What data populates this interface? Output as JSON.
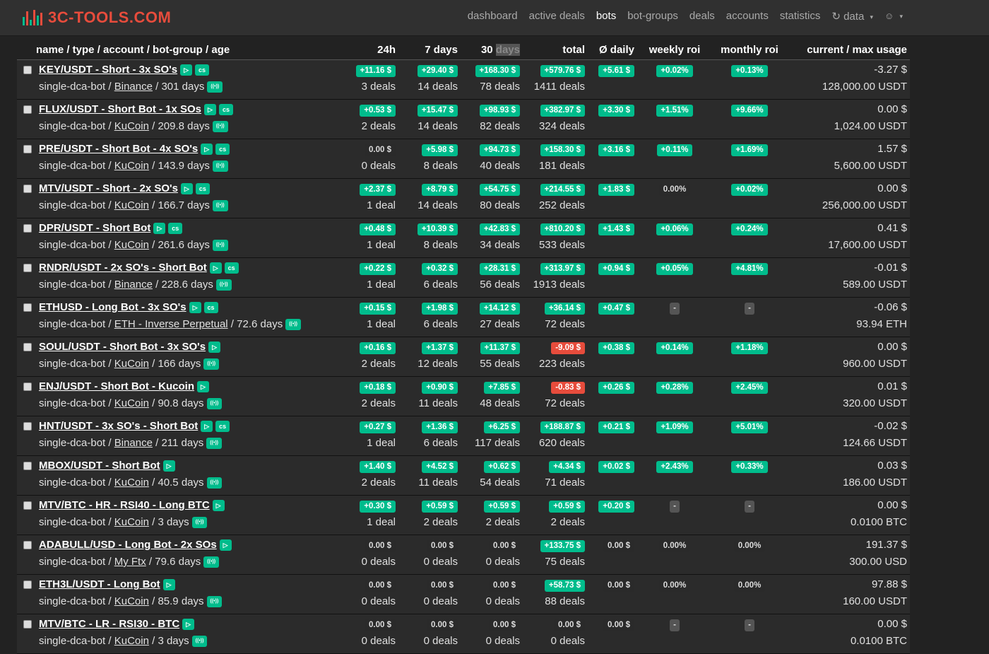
{
  "brand": {
    "title": "3C-TOOLS.COM",
    "logo_colors": [
      "#00bc8c",
      "#e74c3c",
      "#00bc8c",
      "#e74c3c",
      "#00bc8c",
      "#e74c3c"
    ]
  },
  "nav": {
    "items": [
      "dashboard",
      "active deals",
      "bots",
      "bot-groups",
      "deals",
      "accounts",
      "statistics"
    ],
    "active": "bots",
    "data_label": "data"
  },
  "columns": {
    "name": "name / type / account / bot-group / age",
    "h24": "24h",
    "d7": "7 days",
    "d30a": "30",
    "d30b": "days",
    "total": "total",
    "daily": "Ø daily",
    "weekly": "weekly roi",
    "monthly": "monthly roi",
    "usage": "current / max usage"
  },
  "rows": [
    {
      "name": "KEY/USDT - Short - 3x SO's",
      "cs": true,
      "type": "single-dca-bot",
      "exchange": "Binance",
      "age": "301 days",
      "h24": {
        "v": "+11.16 $",
        "c": "green"
      },
      "h24d": "3 deals",
      "d7": {
        "v": "+29.40 $",
        "c": "green"
      },
      "d7d": "14 deals",
      "d30": {
        "v": "+168.30 $",
        "c": "green"
      },
      "d30d": "78 deals",
      "tot": {
        "v": "+579.76 $",
        "c": "green"
      },
      "totd": "1411 deals",
      "daily": {
        "v": "+5.61 $",
        "c": "green"
      },
      "weekly": {
        "v": "+0.02%",
        "c": "green"
      },
      "monthly": {
        "v": "+0.13%",
        "c": "green"
      },
      "cur": "-3.27 $",
      "max": "128,000.00 USDT"
    },
    {
      "name": "FLUX/USDT - Short Bot - 1x SOs",
      "cs": true,
      "type": "single-dca-bot",
      "exchange": "KuCoin",
      "age": "209.8 days",
      "h24": {
        "v": "+0.53 $",
        "c": "green"
      },
      "h24d": "2 deals",
      "d7": {
        "v": "+15.47 $",
        "c": "green"
      },
      "d7d": "14 deals",
      "d30": {
        "v": "+98.93 $",
        "c": "green"
      },
      "d30d": "82 deals",
      "tot": {
        "v": "+382.97 $",
        "c": "green"
      },
      "totd": "324 deals",
      "daily": {
        "v": "+3.30 $",
        "c": "green"
      },
      "weekly": {
        "v": "+1.51%",
        "c": "green"
      },
      "monthly": {
        "v": "+9.66%",
        "c": "green"
      },
      "cur": "0.00 $",
      "max": "1,024.00 USDT"
    },
    {
      "name": "PRE/USDT - Short Bot - 4x SO's",
      "cs": true,
      "type": "single-dca-bot",
      "exchange": "KuCoin",
      "age": "143.9 days",
      "h24": {
        "v": "0.00 $",
        "c": "dark"
      },
      "h24d": "0 deals",
      "d7": {
        "v": "+5.98 $",
        "c": "green"
      },
      "d7d": "8 deals",
      "d30": {
        "v": "+94.73 $",
        "c": "green"
      },
      "d30d": "40 deals",
      "tot": {
        "v": "+158.30 $",
        "c": "green"
      },
      "totd": "181 deals",
      "daily": {
        "v": "+3.16 $",
        "c": "green"
      },
      "weekly": {
        "v": "+0.11%",
        "c": "green"
      },
      "monthly": {
        "v": "+1.69%",
        "c": "green"
      },
      "cur": "1.57 $",
      "max": "5,600.00 USDT"
    },
    {
      "name": "MTV/USDT - Short - 2x SO's",
      "cs": true,
      "type": "single-dca-bot",
      "exchange": "KuCoin",
      "age": "166.7 days",
      "h24": {
        "v": "+2.37 $",
        "c": "green"
      },
      "h24d": "1 deal",
      "d7": {
        "v": "+8.79 $",
        "c": "green"
      },
      "d7d": "14 deals",
      "d30": {
        "v": "+54.75 $",
        "c": "green"
      },
      "d30d": "80 deals",
      "tot": {
        "v": "+214.55 $",
        "c": "green"
      },
      "totd": "252 deals",
      "daily": {
        "v": "+1.83 $",
        "c": "green"
      },
      "weekly": {
        "v": "0.00%",
        "c": "dark"
      },
      "monthly": {
        "v": "+0.02%",
        "c": "green"
      },
      "cur": "0.00 $",
      "max": "256,000.00 USDT"
    },
    {
      "name": "DPR/USDT - Short Bot",
      "cs": true,
      "type": "single-dca-bot",
      "exchange": "KuCoin",
      "age": "261.6 days",
      "h24": {
        "v": "+0.48 $",
        "c": "green"
      },
      "h24d": "1 deal",
      "d7": {
        "v": "+10.39 $",
        "c": "green"
      },
      "d7d": "8 deals",
      "d30": {
        "v": "+42.83 $",
        "c": "green"
      },
      "d30d": "34 deals",
      "tot": {
        "v": "+810.20 $",
        "c": "green"
      },
      "totd": "533 deals",
      "daily": {
        "v": "+1.43 $",
        "c": "green"
      },
      "weekly": {
        "v": "+0.06%",
        "c": "green"
      },
      "monthly": {
        "v": "+0.24%",
        "c": "green"
      },
      "cur": "0.41 $",
      "max": "17,600.00 USDT"
    },
    {
      "name": "RNDR/USDT - 2x SO's - Short Bot",
      "cs": true,
      "type": "single-dca-bot",
      "exchange": "Binance",
      "age": "228.6 days",
      "h24": {
        "v": "+0.22 $",
        "c": "green"
      },
      "h24d": "1 deal",
      "d7": {
        "v": "+0.32 $",
        "c": "green"
      },
      "d7d": "6 deals",
      "d30": {
        "v": "+28.31 $",
        "c": "green"
      },
      "d30d": "56 deals",
      "tot": {
        "v": "+313.97 $",
        "c": "green"
      },
      "totd": "1913 deals",
      "daily": {
        "v": "+0.94 $",
        "c": "green"
      },
      "weekly": {
        "v": "+0.05%",
        "c": "green"
      },
      "monthly": {
        "v": "+4.81%",
        "c": "green"
      },
      "cur": "-0.01 $",
      "max": "589.00 USDT"
    },
    {
      "name": "ETHUSD - Long Bot - 3x SO's",
      "cs": true,
      "type": "single-dca-bot",
      "exchange": "ETH - Inverse Perpetual",
      "age": "72.6 days",
      "h24": {
        "v": "+0.15 $",
        "c": "green"
      },
      "h24d": "1 deal",
      "d7": {
        "v": "+1.98 $",
        "c": "green"
      },
      "d7d": "6 deals",
      "d30": {
        "v": "+14.12 $",
        "c": "green"
      },
      "d30d": "27 deals",
      "tot": {
        "v": "+36.14 $",
        "c": "green"
      },
      "totd": "72 deals",
      "daily": {
        "v": "+0.47 $",
        "c": "green"
      },
      "weekly": {
        "v": "-",
        "c": "dash"
      },
      "monthly": {
        "v": "-",
        "c": "dash"
      },
      "cur": "-0.06 $",
      "max": "93.94 ETH"
    },
    {
      "name": "SOUL/USDT - Short Bot - 3x SO's",
      "cs": false,
      "type": "single-dca-bot",
      "exchange": "KuCoin",
      "age": "166 days",
      "h24": {
        "v": "+0.16 $",
        "c": "green"
      },
      "h24d": "2 deals",
      "d7": {
        "v": "+1.37 $",
        "c": "green"
      },
      "d7d": "12 deals",
      "d30": {
        "v": "+11.37 $",
        "c": "green"
      },
      "d30d": "55 deals",
      "tot": {
        "v": "-9.09 $",
        "c": "red"
      },
      "totd": "223 deals",
      "daily": {
        "v": "+0.38 $",
        "c": "green"
      },
      "weekly": {
        "v": "+0.14%",
        "c": "green"
      },
      "monthly": {
        "v": "+1.18%",
        "c": "green"
      },
      "cur": "0.00 $",
      "max": "960.00 USDT"
    },
    {
      "name": "ENJ/USDT - Short Bot - Kucoin",
      "cs": false,
      "type": "single-dca-bot",
      "exchange": "KuCoin",
      "age": "90.8 days",
      "h24": {
        "v": "+0.18 $",
        "c": "green"
      },
      "h24d": "2 deals",
      "d7": {
        "v": "+0.90 $",
        "c": "green"
      },
      "d7d": "11 deals",
      "d30": {
        "v": "+7.85 $",
        "c": "green"
      },
      "d30d": "48 deals",
      "tot": {
        "v": "-0.83 $",
        "c": "red"
      },
      "totd": "72 deals",
      "daily": {
        "v": "+0.26 $",
        "c": "green"
      },
      "weekly": {
        "v": "+0.28%",
        "c": "green"
      },
      "monthly": {
        "v": "+2.45%",
        "c": "green"
      },
      "cur": "0.01 $",
      "max": "320.00 USDT"
    },
    {
      "name": "HNT/USDT - 3x SO's - Short Bot",
      "cs": true,
      "type": "single-dca-bot",
      "exchange": "Binance",
      "age": "211 days",
      "h24": {
        "v": "+0.27 $",
        "c": "green"
      },
      "h24d": "1 deal",
      "d7": {
        "v": "+1.36 $",
        "c": "green"
      },
      "d7d": "6 deals",
      "d30": {
        "v": "+6.25 $",
        "c": "green"
      },
      "d30d": "117 deals",
      "tot": {
        "v": "+188.87 $",
        "c": "green"
      },
      "totd": "620 deals",
      "daily": {
        "v": "+0.21 $",
        "c": "green"
      },
      "weekly": {
        "v": "+1.09%",
        "c": "green"
      },
      "monthly": {
        "v": "+5.01%",
        "c": "green"
      },
      "cur": "-0.02 $",
      "max": "124.66 USDT"
    },
    {
      "name": "MBOX/USDT - Short Bot",
      "cs": false,
      "type": "single-dca-bot",
      "exchange": "KuCoin",
      "age": "40.5 days",
      "h24": {
        "v": "+1.40 $",
        "c": "green"
      },
      "h24d": "2 deals",
      "d7": {
        "v": "+4.52 $",
        "c": "green"
      },
      "d7d": "11 deals",
      "d30": {
        "v": "+0.62 $",
        "c": "green"
      },
      "d30d": "54 deals",
      "tot": {
        "v": "+4.34 $",
        "c": "green"
      },
      "totd": "71 deals",
      "daily": {
        "v": "+0.02 $",
        "c": "green"
      },
      "weekly": {
        "v": "+2.43%",
        "c": "green"
      },
      "monthly": {
        "v": "+0.33%",
        "c": "green"
      },
      "cur": "0.03 $",
      "max": "186.00 USDT"
    },
    {
      "name": "MTV/BTC - HR - RSI40 - Long BTC",
      "cs": false,
      "type": "single-dca-bot",
      "exchange": "KuCoin",
      "age": "3 days",
      "h24": {
        "v": "+0.30 $",
        "c": "green"
      },
      "h24d": "1 deal",
      "d7": {
        "v": "+0.59 $",
        "c": "green"
      },
      "d7d": "2 deals",
      "d30": {
        "v": "+0.59 $",
        "c": "green"
      },
      "d30d": "2 deals",
      "tot": {
        "v": "+0.59 $",
        "c": "green"
      },
      "totd": "2 deals",
      "daily": {
        "v": "+0.20 $",
        "c": "green"
      },
      "weekly": {
        "v": "-",
        "c": "dash"
      },
      "monthly": {
        "v": "-",
        "c": "dash"
      },
      "cur": "0.00 $",
      "max": "0.0100 BTC"
    },
    {
      "name": "ADABULL/USD - Long Bot - 2x SOs",
      "cs": false,
      "type": "single-dca-bot",
      "exchange": "My Ftx",
      "age": "79.6 days",
      "h24": {
        "v": "0.00 $",
        "c": "dark"
      },
      "h24d": "0 deals",
      "d7": {
        "v": "0.00 $",
        "c": "dark"
      },
      "d7d": "0 deals",
      "d30": {
        "v": "0.00 $",
        "c": "dark"
      },
      "d30d": "0 deals",
      "tot": {
        "v": "+133.75 $",
        "c": "green"
      },
      "totd": "75 deals",
      "daily": {
        "v": "0.00 $",
        "c": "dark"
      },
      "weekly": {
        "v": "0.00%",
        "c": "dark"
      },
      "monthly": {
        "v": "0.00%",
        "c": "dark"
      },
      "cur": "191.37 $",
      "max": "300.00 USD"
    },
    {
      "name": "ETH3L/USDT - Long Bot",
      "cs": false,
      "type": "single-dca-bot",
      "exchange": "KuCoin",
      "age": "85.9 days",
      "h24": {
        "v": "0.00 $",
        "c": "dark"
      },
      "h24d": "0 deals",
      "d7": {
        "v": "0.00 $",
        "c": "dark"
      },
      "d7d": "0 deals",
      "d30": {
        "v": "0.00 $",
        "c": "dark"
      },
      "d30d": "0 deals",
      "tot": {
        "v": "+58.73 $",
        "c": "green"
      },
      "totd": "88 deals",
      "daily": {
        "v": "0.00 $",
        "c": "dark"
      },
      "weekly": {
        "v": "0.00%",
        "c": "dark"
      },
      "monthly": {
        "v": "0.00%",
        "c": "dark"
      },
      "cur": "97.88 $",
      "max": "160.00 USDT"
    },
    {
      "name": "MTV/BTC - LR - RSI30 - BTC",
      "cs": false,
      "type": "single-dca-bot",
      "exchange": "KuCoin",
      "age": "3 days",
      "h24": {
        "v": "0.00 $",
        "c": "dark"
      },
      "h24d": "0 deals",
      "d7": {
        "v": "0.00 $",
        "c": "dark"
      },
      "d7d": "0 deals",
      "d30": {
        "v": "0.00 $",
        "c": "dark"
      },
      "d30d": "0 deals",
      "tot": {
        "v": "0.00 $",
        "c": "dark"
      },
      "totd": "0 deals",
      "daily": {
        "v": "0.00 $",
        "c": "dark"
      },
      "weekly": {
        "v": "-",
        "c": "dash"
      },
      "monthly": {
        "v": "-",
        "c": "dash"
      },
      "cur": "0.00 $",
      "max": "0.0100 BTC"
    }
  ],
  "icons": {
    "play": "▷",
    "cs": "cs",
    "signal": "((•))",
    "caret": "▾",
    "refresh": "↻",
    "user": "👤"
  }
}
